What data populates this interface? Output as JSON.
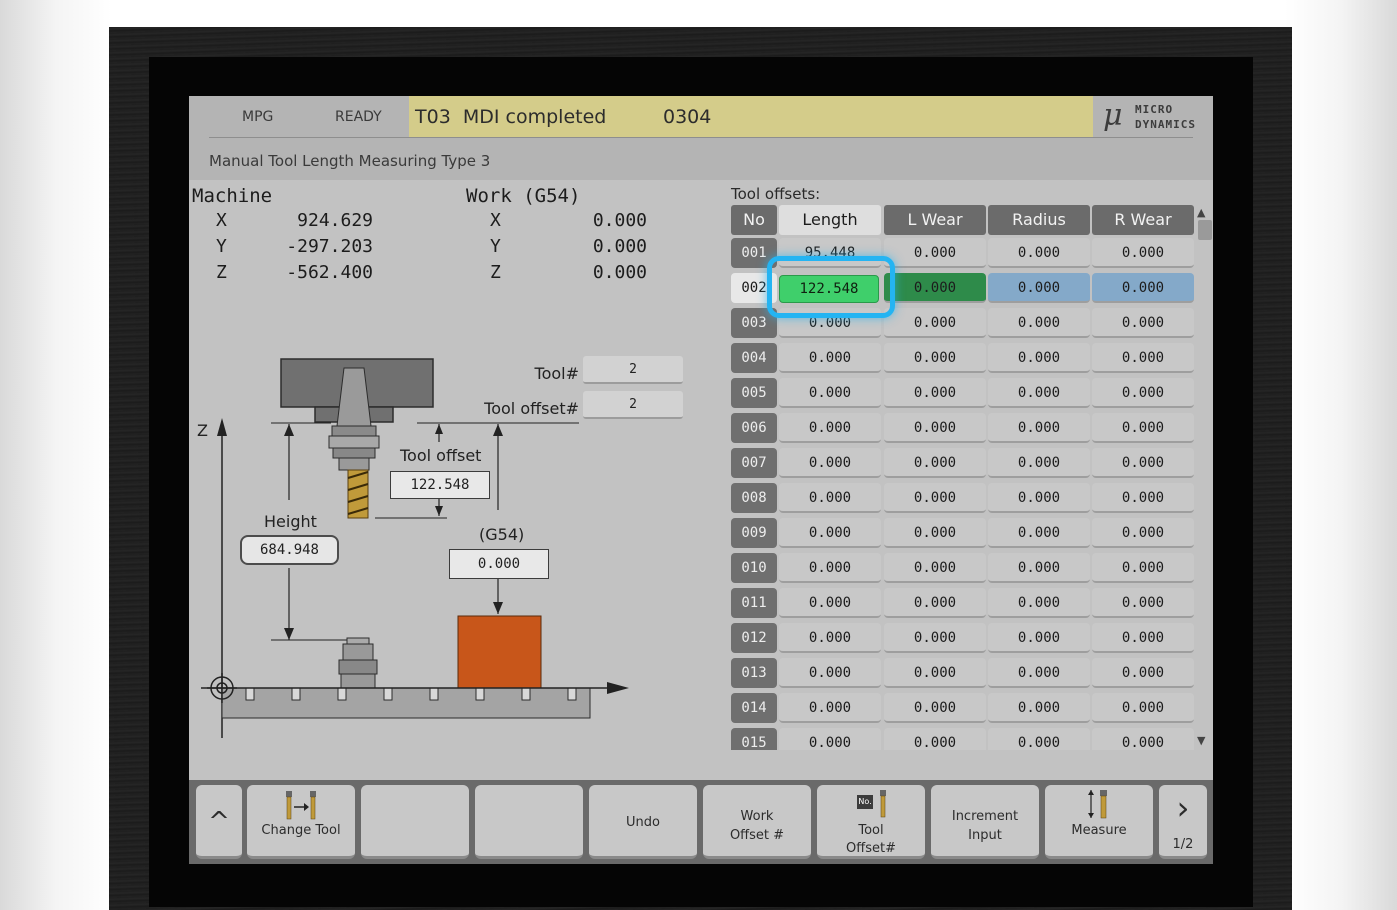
{
  "status": {
    "mode": "MPG",
    "state": "READY",
    "message": "T03  MDI completed",
    "program": "0304",
    "brand_line1": "MICRO",
    "brand_line2": "DYNAMICS"
  },
  "page_title": "Manual Tool Length Measuring Type 3",
  "machine": {
    "title": "Machine",
    "axes": [
      {
        "axis": "X",
        "value": "924.629"
      },
      {
        "axis": "Y",
        "value": "-297.203"
      },
      {
        "axis": "Z",
        "value": "-562.400"
      }
    ]
  },
  "work": {
    "title": "Work (G54)",
    "axes": [
      {
        "axis": "X",
        "value": "0.000"
      },
      {
        "axis": "Y",
        "value": "0.000"
      },
      {
        "axis": "Z",
        "value": "0.000"
      }
    ]
  },
  "tool_info": {
    "tool_label": "Tool#",
    "tool_value": "2",
    "offset_label": "Tool offset#",
    "offset_value": "2"
  },
  "diagram": {
    "z_label": "Z",
    "tool_offset_label": "Tool offset",
    "tool_offset_value": "122.548",
    "height_label": "Height",
    "height_value": "684.948",
    "g54_label": "(G54)",
    "g54_value": "0.000"
  },
  "tool_offsets": {
    "title": "Tool offsets:",
    "columns": [
      "No",
      "Length",
      "L Wear",
      "Radius",
      "R Wear"
    ],
    "rows": [
      {
        "no": "001",
        "length": "95.448",
        "lwear": "0.000",
        "radius": "0.000",
        "rwear": "0.000"
      },
      {
        "no": "002",
        "length": "122.548",
        "lwear": "0.000",
        "radius": "0.000",
        "rwear": "0.000"
      },
      {
        "no": "003",
        "length": "0.000",
        "lwear": "0.000",
        "radius": "0.000",
        "rwear": "0.000"
      },
      {
        "no": "004",
        "length": "0.000",
        "lwear": "0.000",
        "radius": "0.000",
        "rwear": "0.000"
      },
      {
        "no": "005",
        "length": "0.000",
        "lwear": "0.000",
        "radius": "0.000",
        "rwear": "0.000"
      },
      {
        "no": "006",
        "length": "0.000",
        "lwear": "0.000",
        "radius": "0.000",
        "rwear": "0.000"
      },
      {
        "no": "007",
        "length": "0.000",
        "lwear": "0.000",
        "radius": "0.000",
        "rwear": "0.000"
      },
      {
        "no": "008",
        "length": "0.000",
        "lwear": "0.000",
        "radius": "0.000",
        "rwear": "0.000"
      },
      {
        "no": "009",
        "length": "0.000",
        "lwear": "0.000",
        "radius": "0.000",
        "rwear": "0.000"
      },
      {
        "no": "010",
        "length": "0.000",
        "lwear": "0.000",
        "radius": "0.000",
        "rwear": "0.000"
      },
      {
        "no": "011",
        "length": "0.000",
        "lwear": "0.000",
        "radius": "0.000",
        "rwear": "0.000"
      },
      {
        "no": "012",
        "length": "0.000",
        "lwear": "0.000",
        "radius": "0.000",
        "rwear": "0.000"
      },
      {
        "no": "013",
        "length": "0.000",
        "lwear": "0.000",
        "radius": "0.000",
        "rwear": "0.000"
      },
      {
        "no": "014",
        "length": "0.000",
        "lwear": "0.000",
        "radius": "0.000",
        "rwear": "0.000"
      },
      {
        "no": "015",
        "length": "0.000",
        "lwear": "0.000",
        "radius": "0.000",
        "rwear": "0.000"
      }
    ]
  },
  "softkeys": {
    "up_icon": "caret-up-icon",
    "change_tool": "Change Tool",
    "undo": "Undo",
    "work_offset_l1": "Work",
    "work_offset_l2": "Offset #",
    "tool_offset_l1": "Tool",
    "tool_offset_l2": "Offset#",
    "tool_offset_badge": "No.",
    "increment_l1": "Increment",
    "increment_l2": "Input",
    "measure": "Measure",
    "page": "1/2",
    "next_icon": "chevron-right-icon"
  },
  "colors": {
    "message_bg": "#d4cc8a",
    "selected_length": "#3fcf6b",
    "selected_row_green": "#2e8b4a",
    "selected_row_blue": "#84a9c9",
    "focus_ring": "#24b4f2",
    "workpiece": "#c8561a"
  }
}
